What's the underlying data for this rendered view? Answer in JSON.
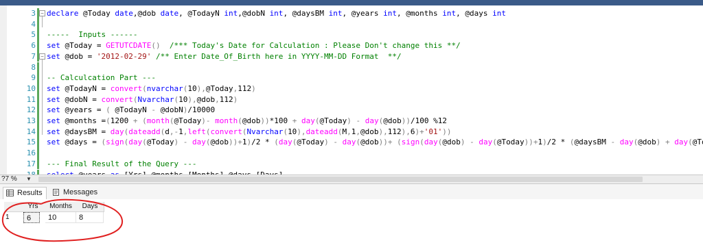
{
  "title_strip": "",
  "code_lines": [
    {
      "no": "3",
      "fold": "start",
      "parts": [
        [
          "kw",
          "declare"
        ],
        [
          "t",
          " @Today "
        ],
        [
          "kw",
          "date"
        ],
        [
          "t",
          ",@dob "
        ],
        [
          "kw",
          "date"
        ],
        [
          "t",
          ", @TodayN "
        ],
        [
          "kw",
          "int"
        ],
        [
          "t",
          ",@dobN "
        ],
        [
          "kw",
          "int"
        ],
        [
          "t",
          ", @daysBM "
        ],
        [
          "kw",
          "int"
        ],
        [
          "t",
          ", @years "
        ],
        [
          "kw",
          "int"
        ],
        [
          "t",
          ", @months "
        ],
        [
          "kw",
          "int"
        ],
        [
          "t",
          ", @days "
        ],
        [
          "kw",
          "int"
        ]
      ]
    },
    {
      "no": "4",
      "parts": []
    },
    {
      "no": "5",
      "parts": [
        [
          "cm",
          "-----  Inputs ------"
        ]
      ]
    },
    {
      "no": "6",
      "parts": [
        [
          "kw",
          "set"
        ],
        [
          "t",
          " @Today = "
        ],
        [
          "fn",
          "GETUTCDATE"
        ],
        [
          "gr",
          "()"
        ],
        [
          "t",
          "  "
        ],
        [
          "cm",
          "/*** Today's Date for Calculation : Please Don't change this **/"
        ]
      ]
    },
    {
      "no": "7",
      "fold": "start",
      "parts": [
        [
          "kw",
          "set"
        ],
        [
          "t",
          " @dob = "
        ],
        [
          "str",
          "'2012-02-29'"
        ],
        [
          "t",
          " "
        ],
        [
          "cm",
          "/** Enter Date_Of_Birth here in YYYY-MM-DD Format  **/"
        ]
      ]
    },
    {
      "no": "8",
      "parts": []
    },
    {
      "no": "9",
      "parts": [
        [
          "cm",
          "-- Calculcation Part ---"
        ]
      ]
    },
    {
      "no": "10",
      "parts": [
        [
          "kw",
          "set"
        ],
        [
          "t",
          " @TodayN = "
        ],
        [
          "fn",
          "convert"
        ],
        [
          "gr",
          "("
        ],
        [
          "kw",
          "nvarchar"
        ],
        [
          "gr",
          "("
        ],
        [
          "t",
          "10"
        ],
        [
          "gr",
          "),"
        ],
        [
          "t",
          "@Today"
        ],
        [
          "gr",
          ","
        ],
        [
          "t",
          "112"
        ],
        [
          "gr",
          ")"
        ]
      ]
    },
    {
      "no": "11",
      "parts": [
        [
          "kw",
          "set"
        ],
        [
          "t",
          " @dobN = "
        ],
        [
          "fn",
          "convert"
        ],
        [
          "gr",
          "("
        ],
        [
          "kw",
          "Nvarchar"
        ],
        [
          "gr",
          "("
        ],
        [
          "t",
          "10"
        ],
        [
          "gr",
          "),"
        ],
        [
          "t",
          "@dob"
        ],
        [
          "gr",
          ","
        ],
        [
          "t",
          "112"
        ],
        [
          "gr",
          ")"
        ]
      ]
    },
    {
      "no": "12",
      "parts": [
        [
          "kw",
          "set"
        ],
        [
          "t",
          " @years = "
        ],
        [
          "gr",
          "( "
        ],
        [
          "t",
          "@TodayN "
        ],
        [
          "gr",
          "-"
        ],
        [
          "t",
          " @dobN"
        ],
        [
          "gr",
          ")"
        ],
        [
          "t",
          "/10000"
        ]
      ]
    },
    {
      "no": "13",
      "parts": [
        [
          "kw",
          "set"
        ],
        [
          "t",
          " @months ="
        ],
        [
          "gr",
          "("
        ],
        [
          "t",
          "1200 "
        ],
        [
          "gr",
          "+ ("
        ],
        [
          "fn",
          "month"
        ],
        [
          "gr",
          "("
        ],
        [
          "t",
          "@Today"
        ],
        [
          "gr",
          ")- "
        ],
        [
          "fn",
          "month"
        ],
        [
          "gr",
          "("
        ],
        [
          "t",
          "@dob"
        ],
        [
          "gr",
          "))"
        ],
        [
          "t",
          "*100 "
        ],
        [
          "gr",
          "+ "
        ],
        [
          "fn",
          "day"
        ],
        [
          "gr",
          "("
        ],
        [
          "t",
          "@Today"
        ],
        [
          "gr",
          ") - "
        ],
        [
          "fn",
          "day"
        ],
        [
          "gr",
          "("
        ],
        [
          "t",
          "@dob"
        ],
        [
          "gr",
          "))"
        ],
        [
          "t",
          "/100 %12"
        ]
      ]
    },
    {
      "no": "14",
      "parts": [
        [
          "kw",
          "set"
        ],
        [
          "t",
          " @daysBM = "
        ],
        [
          "fn",
          "day"
        ],
        [
          "gr",
          "("
        ],
        [
          "fn",
          "dateadd"
        ],
        [
          "gr",
          "("
        ],
        [
          "t",
          "d"
        ],
        [
          "gr",
          ",-"
        ],
        [
          "t",
          "1"
        ],
        [
          "gr",
          ","
        ],
        [
          "fn",
          "left"
        ],
        [
          "gr",
          "("
        ],
        [
          "fn",
          "convert"
        ],
        [
          "gr",
          "("
        ],
        [
          "kw",
          "Nvarchar"
        ],
        [
          "gr",
          "("
        ],
        [
          "t",
          "10"
        ],
        [
          "gr",
          "),"
        ],
        [
          "fn",
          "dateadd"
        ],
        [
          "gr",
          "("
        ],
        [
          "t",
          "M"
        ],
        [
          "gr",
          ","
        ],
        [
          "t",
          "1"
        ],
        [
          "gr",
          ","
        ],
        [
          "t",
          "@dob"
        ],
        [
          "gr",
          "),"
        ],
        [
          "t",
          "112"
        ],
        [
          "gr",
          "),"
        ],
        [
          "t",
          "6"
        ],
        [
          "gr",
          ")+"
        ],
        [
          "str",
          "'01'"
        ],
        [
          "gr",
          "))"
        ]
      ]
    },
    {
      "no": "15",
      "parts": [
        [
          "kw",
          "set"
        ],
        [
          "t",
          " @days = "
        ],
        [
          "gr",
          "("
        ],
        [
          "fn",
          "sign"
        ],
        [
          "gr",
          "("
        ],
        [
          "fn",
          "day"
        ],
        [
          "gr",
          "("
        ],
        [
          "t",
          "@Today"
        ],
        [
          "gr",
          ") - "
        ],
        [
          "fn",
          "day"
        ],
        [
          "gr",
          "("
        ],
        [
          "t",
          "@dob"
        ],
        [
          "gr",
          "))+"
        ],
        [
          "t",
          "1"
        ],
        [
          "gr",
          ")"
        ],
        [
          "t",
          "/2 * "
        ],
        [
          "gr",
          "("
        ],
        [
          "fn",
          "day"
        ],
        [
          "gr",
          "("
        ],
        [
          "t",
          "@Today"
        ],
        [
          "gr",
          ") - "
        ],
        [
          "fn",
          "day"
        ],
        [
          "gr",
          "("
        ],
        [
          "t",
          "@dob"
        ],
        [
          "gr",
          "))+ ("
        ],
        [
          "fn",
          "sign"
        ],
        [
          "gr",
          "("
        ],
        [
          "fn",
          "day"
        ],
        [
          "gr",
          "("
        ],
        [
          "t",
          "@dob"
        ],
        [
          "gr",
          ") - "
        ],
        [
          "fn",
          "day"
        ],
        [
          "gr",
          "("
        ],
        [
          "t",
          "@Today"
        ],
        [
          "gr",
          "))+"
        ],
        [
          "t",
          "1"
        ],
        [
          "gr",
          ")"
        ],
        [
          "t",
          "/2 * "
        ],
        [
          "gr",
          "("
        ],
        [
          "t",
          "@daysBM "
        ],
        [
          "gr",
          "- "
        ],
        [
          "fn",
          "day"
        ],
        [
          "gr",
          "("
        ],
        [
          "t",
          "@dob"
        ],
        [
          "gr",
          ") + "
        ],
        [
          "fn",
          "day"
        ],
        [
          "gr",
          "("
        ],
        [
          "t",
          "@Today"
        ],
        [
          "gr",
          "))"
        ]
      ]
    },
    {
      "no": "16",
      "parts": []
    },
    {
      "no": "17",
      "parts": [
        [
          "cm",
          "--- Final Result of the Query ---"
        ]
      ]
    },
    {
      "no": "18",
      "parts": [
        [
          "kw",
          "select"
        ],
        [
          "t",
          " @years "
        ],
        [
          "kw",
          "as"
        ],
        [
          "t",
          " [Yrs],@months [Months],@days [Days]"
        ]
      ]
    }
  ],
  "zoom": {
    "value": "?7 %",
    "dropdown": "▼"
  },
  "tabs": [
    {
      "label": "Results",
      "icon": "grid-icon",
      "active": true
    },
    {
      "label": "Messages",
      "icon": "messages-icon",
      "active": false
    }
  ],
  "results": {
    "columns": [
      "Yrs",
      "Months",
      "Days"
    ],
    "rows": [
      {
        "rownum": "1",
        "values": [
          "6",
          "10",
          "8"
        ]
      }
    ]
  },
  "annotation_color": "#e02020"
}
